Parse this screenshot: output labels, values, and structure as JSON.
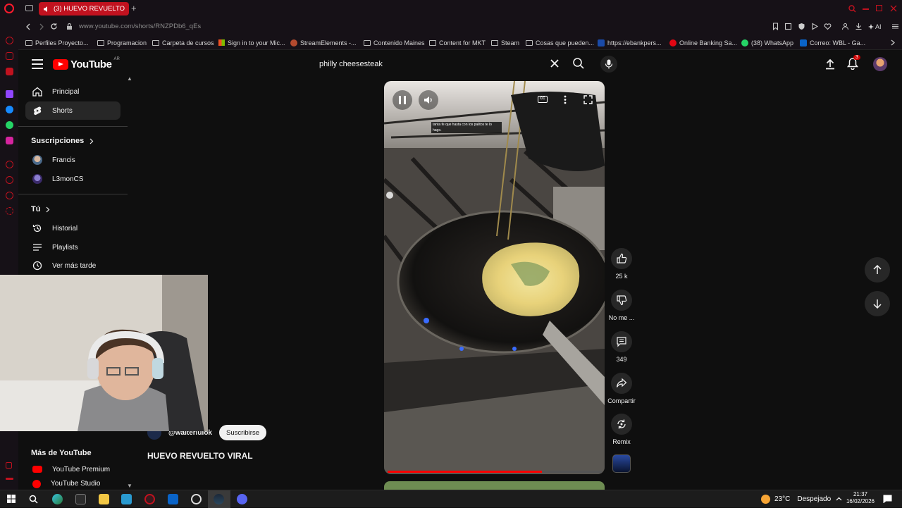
{
  "browser": {
    "tab_title": "(3) HUEVO REVUELTO",
    "url": "www.youtube.com/shorts/RNZPDb6_qEs",
    "ai_label": "AI",
    "bookmarks": [
      "Perfiles Proyecto...",
      "Programacion",
      "Carpeta de cursos",
      "Sign in to your Mic...",
      "StreamElements -...",
      "Contenido Maines",
      "Content for MKT",
      "Steam",
      "Cosas que pueden...",
      "https://ebankpers...",
      "Online Banking Sa...",
      "(38) WhatsApp",
      "Correo: WBL - Ga..."
    ]
  },
  "youtube": {
    "logo_text": "YouTube",
    "region": "AR",
    "search_query": "philly cheesesteak",
    "notifications_badge": "3",
    "sidebar": {
      "nav": [
        "Principal",
        "Shorts"
      ],
      "subscriptions_header": "Suscripciones",
      "subscriptions": [
        "Francis",
        "L3monCS"
      ],
      "you_header": "Tú",
      "you_items": [
        "Historial",
        "Playlists",
        "Ver más tarde"
      ],
      "more_header": "Más de YouTube",
      "more_items": [
        "YouTube Premium",
        "YouTube Studio"
      ]
    },
    "video": {
      "channel": "@walteriulok",
      "subscribe_label": "Suscribirse",
      "title": "HUEVO REVUELTO VIRAL",
      "caption": "tanta fe que hasta con los palitos te lo hago.",
      "progress": 0.72,
      "actions": {
        "likes": "25 k",
        "dislike": "No me ...",
        "comments": "349",
        "share": "Compartir",
        "remix": "Remix"
      }
    }
  },
  "taskbar": {
    "weather": "23°C",
    "weather_desc": "Despejado",
    "time": "21:37",
    "date": "16/02/2026"
  },
  "colors": {
    "brand_red": "#ff0000",
    "opera_red": "#c1121f",
    "background": "#0f0f0f"
  }
}
